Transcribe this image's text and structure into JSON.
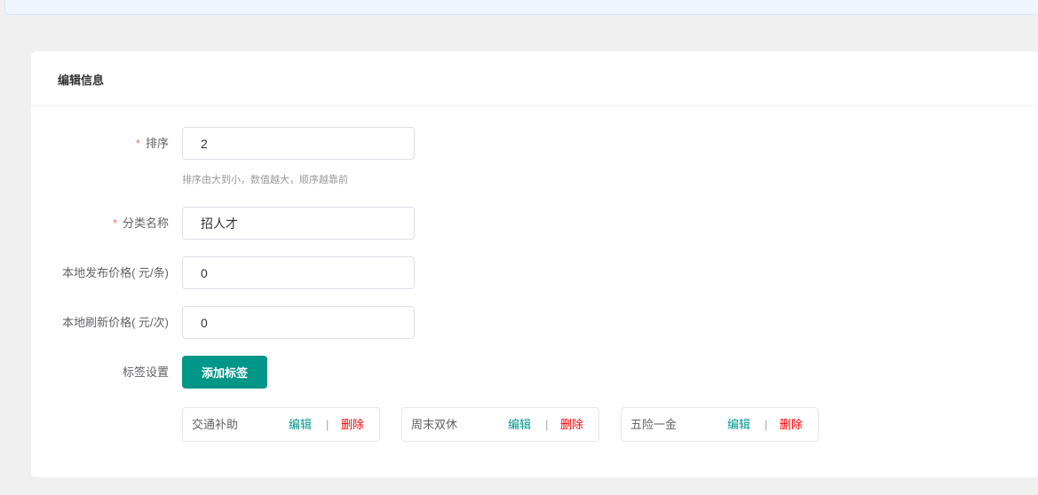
{
  "card_title": "编辑信息",
  "form": {
    "sort": {
      "label": "排序",
      "value": "2",
      "hint": "排序由大到小，数值越大，顺序越靠前",
      "required_mark": "*"
    },
    "category": {
      "label": "分类名称",
      "value": "招人才",
      "required_mark": "*"
    },
    "local_publish_price": {
      "label": "本地发布价格( 元/条)",
      "value": "0"
    },
    "local_refresh_price": {
      "label": "本地刷新价格( 元/次)",
      "value": "0"
    },
    "tags": {
      "label": "标签设置",
      "add_button": "添加标签"
    }
  },
  "tags": [
    {
      "name": "交通补助",
      "edit": "编辑",
      "sep": "|",
      "delete": "删除"
    },
    {
      "name": "周末双休",
      "edit": "编辑",
      "sep": "|",
      "delete": "删除"
    },
    {
      "name": "五险一金",
      "edit": "编辑",
      "sep": "|",
      "delete": "删除"
    }
  ],
  "colors": {
    "accent": "#009688",
    "danger": "#ff0000",
    "required": "#f56c6c"
  }
}
